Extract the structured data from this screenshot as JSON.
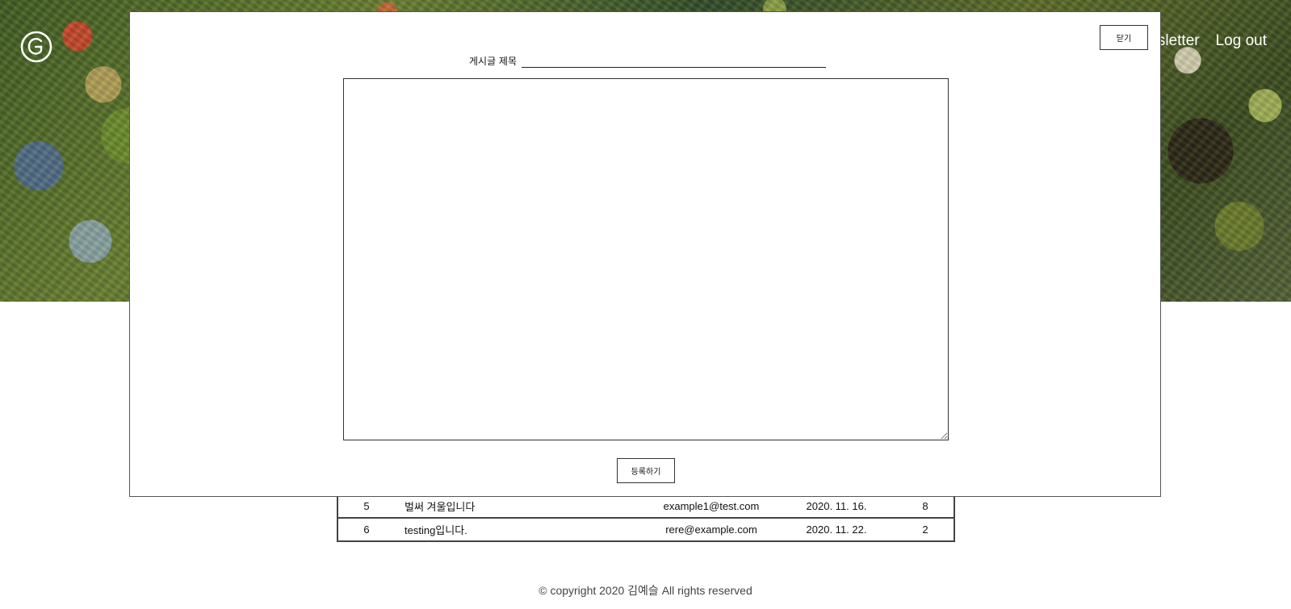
{
  "header": {
    "logo_letter": "G",
    "nav": [
      {
        "label": "Newsletter"
      },
      {
        "label": "Log out"
      }
    ]
  },
  "board": {
    "rows": [
      {
        "num": "5",
        "title": "벌써 겨울입니다",
        "email": "example1@test.com",
        "date": "2020. 11. 16.",
        "views": "8"
      },
      {
        "num": "6",
        "title": "testing입니다.",
        "email": "rere@example.com",
        "date": "2020. 11. 22.",
        "views": "2"
      }
    ]
  },
  "footer": {
    "text": "© copyright 2020 김예슬 All rights reserved"
  },
  "modal": {
    "close_label": "닫기",
    "title_label": "게시글 제목",
    "title_value": "",
    "content_value": "",
    "submit_label": "등록하기"
  }
}
